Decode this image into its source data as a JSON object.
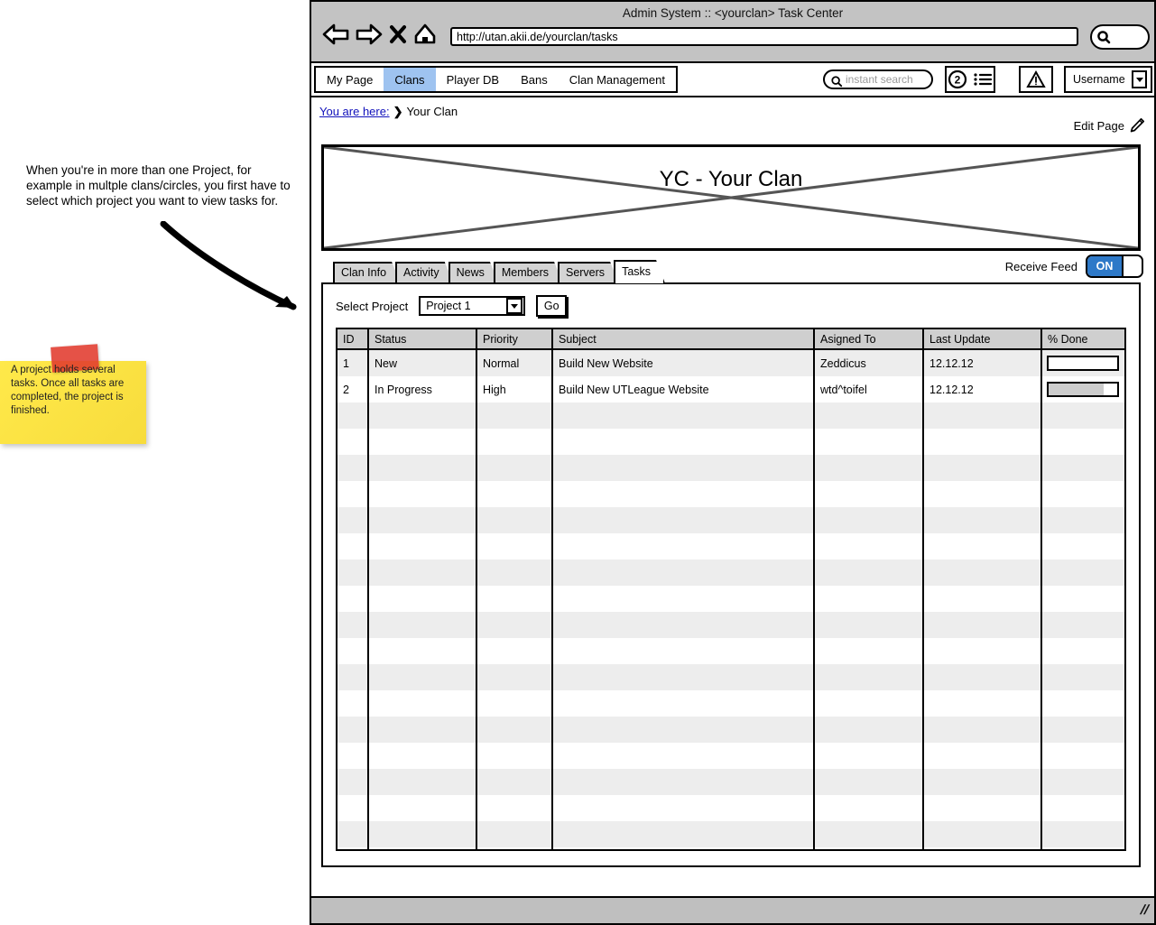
{
  "annotations": {
    "callout_text": "When you're in more than one Project, for example in multple clans/circles, you first have to select which project you want to view tasks for.",
    "sticky_text": "A project holds several tasks. Once all tasks are completed, the project is finished."
  },
  "browser": {
    "window_title": "Admin System :: <yourclan> Task Center",
    "url": "http://utan.akii.de/yourclan/tasks",
    "nav": {
      "back": "back-arrow",
      "forward": "forward-arrow",
      "stop": "stop-x",
      "home": "home"
    },
    "chrome_search_icon": "search-icon"
  },
  "appbar": {
    "menu": [
      {
        "label": "My Page",
        "active": false
      },
      {
        "label": "Clans",
        "active": true
      },
      {
        "label": "Player DB",
        "active": false
      },
      {
        "label": "Bans",
        "active": false
      },
      {
        "label": "Clan Management",
        "active": false
      }
    ],
    "instant_search_placeholder": "instant search",
    "notification_count": "2",
    "username": "Username"
  },
  "page": {
    "breadcrumb": {
      "link": "You are here:",
      "separator": "❯",
      "current": "Your Clan"
    },
    "edit_page_label": "Edit Page",
    "banner_title": "YC - Your Clan"
  },
  "tabs": [
    {
      "label": "Clan Info",
      "active": false
    },
    {
      "label": "Activity",
      "active": false
    },
    {
      "label": "News",
      "active": false
    },
    {
      "label": "Members",
      "active": false
    },
    {
      "label": "Servers",
      "active": false
    },
    {
      "label": "Tasks",
      "active": true
    }
  ],
  "feed": {
    "label": "Receive Feed",
    "state": "ON",
    "color": "#2E79C8"
  },
  "project_selector": {
    "label": "Select Project",
    "selected": "Project 1",
    "options": [
      "Project 1"
    ],
    "go_label": "Go"
  },
  "table": {
    "columns": [
      "ID",
      "Status",
      "Priority",
      "Subject",
      "Asigned To",
      "Last Update",
      "% Done"
    ],
    "rows": [
      {
        "id": "1",
        "status": "New",
        "priority": "Normal",
        "subject": "Build New Website",
        "assigned_to": "Zeddicus",
        "last_update": "12.12.12",
        "percent_done": 0
      },
      {
        "id": "2",
        "status": "In Progress",
        "priority": "High",
        "subject": "Build New UTLeague Website",
        "assigned_to": "wtd^toifel",
        "last_update": "12.12.12",
        "percent_done": 80
      }
    ],
    "empty_rows": 18
  }
}
